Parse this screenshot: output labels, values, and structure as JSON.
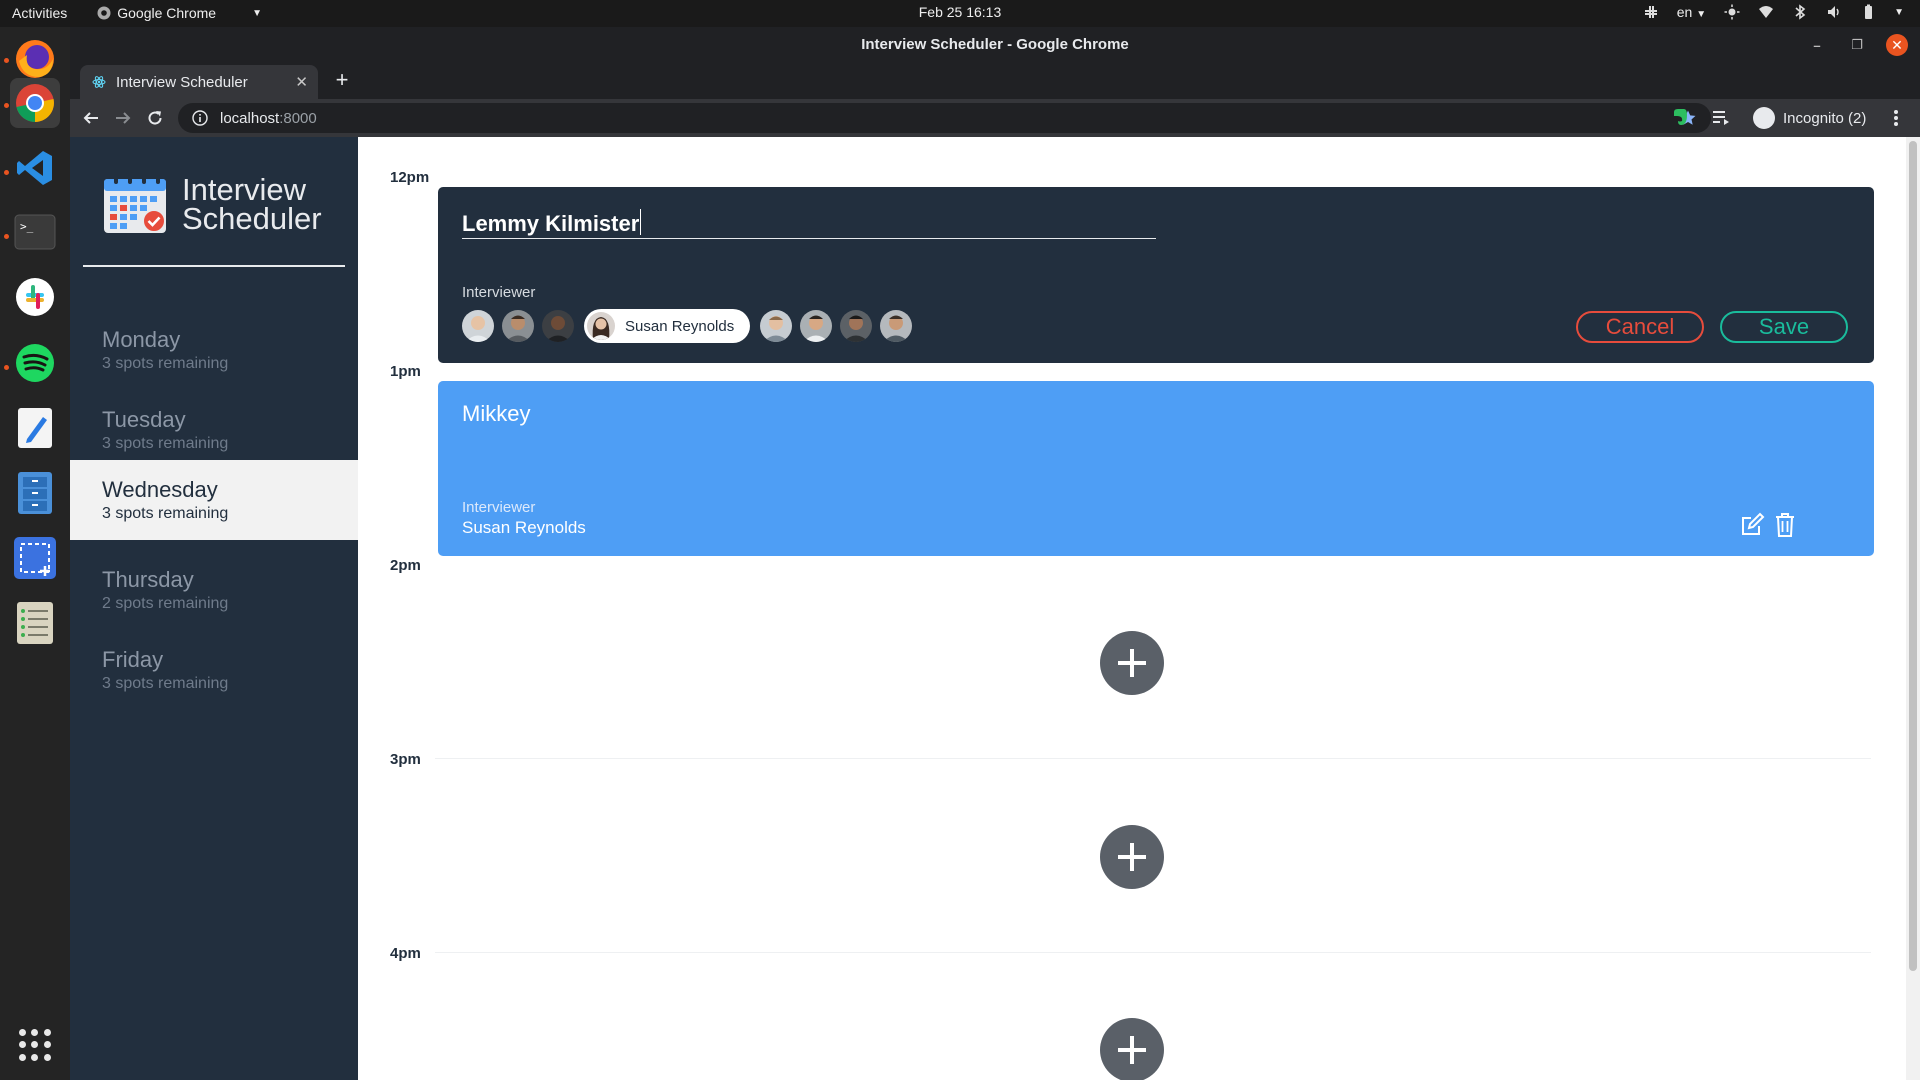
{
  "system": {
    "activities": "Activities",
    "app_menu": "Google Chrome",
    "clock": "Feb 25  16:13",
    "language": "en"
  },
  "window": {
    "title": "Interview Scheduler - Google Chrome"
  },
  "browser": {
    "tab_title": "Interview Scheduler",
    "url_host": "localhost",
    "url_port": ":8000",
    "profile": "Incognito (2)"
  },
  "brand": {
    "title_line1": "Interview",
    "title_line2": "Scheduler"
  },
  "days": [
    {
      "name": "Monday",
      "spots": "3 spots remaining"
    },
    {
      "name": "Tuesday",
      "spots": "3 spots remaining"
    },
    {
      "name": "Wednesday",
      "spots": "3 spots remaining"
    },
    {
      "name": "Thursday",
      "spots": "2 spots remaining"
    },
    {
      "name": "Friday",
      "spots": "3 spots remaining"
    }
  ],
  "selected_day": "Wednesday",
  "schedule": {
    "times": [
      "12pm",
      "1pm",
      "2pm",
      "3pm",
      "4pm"
    ],
    "form": {
      "student_name": "Lemmy Kilmister",
      "interviewer_label": "Interviewer",
      "selected_interviewer": "Susan Reynolds",
      "cancel_label": "Cancel",
      "save_label": "Save"
    },
    "appointment": {
      "student": "Mikkey",
      "interviewer_label": "Interviewer",
      "interviewer": "Susan Reynolds"
    }
  },
  "colors": {
    "sidebar": "#222f3e",
    "appointment_card": "#4e9ef5",
    "cancel": "#e74c3c",
    "save": "#1abc9c",
    "add_button": "#5a6068"
  },
  "icons": [
    "firefox-icon",
    "chrome-icon",
    "vscode-icon",
    "terminal-icon",
    "slack-icon",
    "spotify-icon",
    "text-editor-icon",
    "files-icon",
    "screenshot-icon",
    "notes-icon",
    "app-grid-icon",
    "edit-icon",
    "trash-icon",
    "add-icon",
    "calendar-logo-icon"
  ]
}
